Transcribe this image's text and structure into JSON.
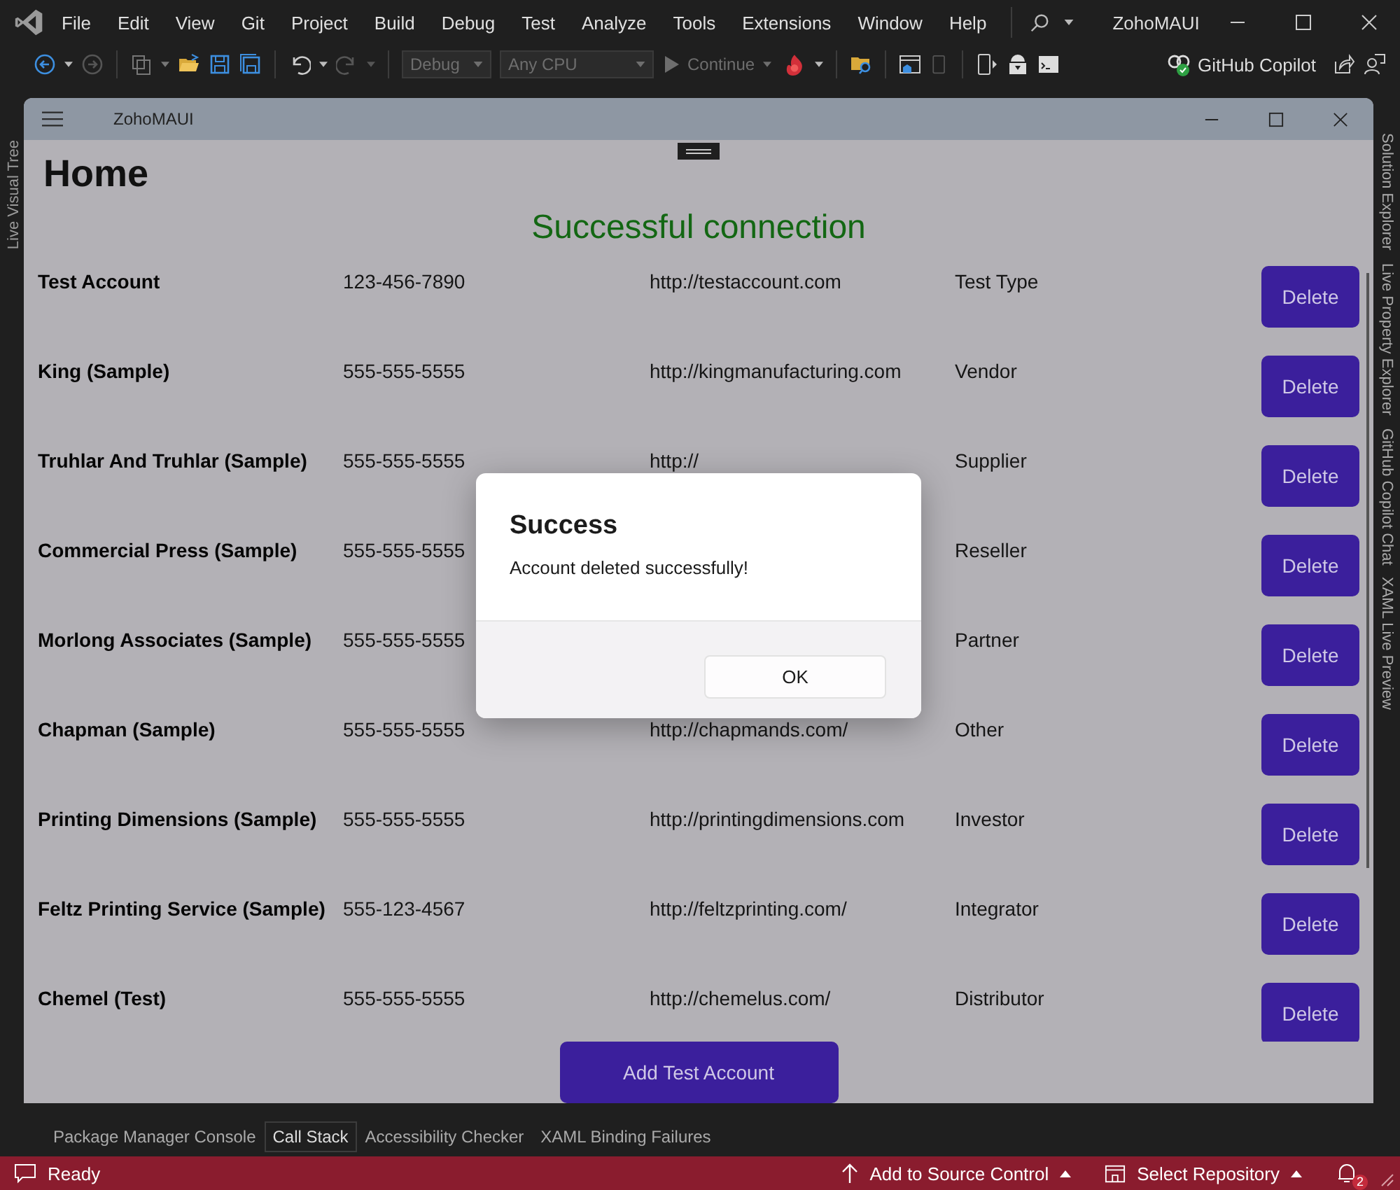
{
  "ide": {
    "menu": [
      "File",
      "Edit",
      "View",
      "Git",
      "Project",
      "Build",
      "Debug",
      "Test",
      "Analyze",
      "Tools",
      "Extensions",
      "Window",
      "Help"
    ],
    "title": "ZohoMAUI",
    "toolbar": {
      "configuration": {
        "value": "Debug",
        "disabled": true
      },
      "platform": {
        "value": "Any CPU",
        "disabled": true
      },
      "continue": {
        "label": "Continue",
        "disabled": true
      },
      "copilot": "GitHub Copilot"
    },
    "left_tabs": [
      "Live Visual Tree"
    ],
    "right_tabs": [
      "Solution Explorer",
      "Live Property Explorer",
      "GitHub Copilot Chat",
      "XAML Live Preview"
    ],
    "bottom_tabs": [
      {
        "label": "Package Manager Console",
        "selected": false
      },
      {
        "label": "Call Stack",
        "selected": true
      },
      {
        "label": "Accessibility Checker",
        "selected": false
      },
      {
        "label": "XAML Binding Failures",
        "selected": false
      }
    ],
    "status_bar": {
      "status": "Ready",
      "source_control": "Add to Source Control",
      "repository": "Select Repository",
      "notifications": "2"
    }
  },
  "app": {
    "title": "ZohoMAUI",
    "heading": "Home",
    "message": "Successful connection",
    "accounts": [
      {
        "name": "Test Account",
        "phone": "123-456-7890",
        "url": "http://testaccount.com",
        "type": "Test Type",
        "action": "Delete"
      },
      {
        "name": "King (Sample)",
        "phone": "555-555-5555",
        "url": "http://kingmanufacturing.com",
        "type": "Vendor",
        "action": "Delete"
      },
      {
        "name": "Truhlar And Truhlar (Sample)",
        "phone": "555-555-5555",
        "url": "http://",
        "type": "Supplier",
        "action": "Delete"
      },
      {
        "name": "Commercial Press (Sample)",
        "phone": "555-555-5555",
        "type": "Reseller",
        "action": "Delete"
      },
      {
        "name": "Morlong Associates (Sample)",
        "phone": "555-555-5555",
        "type": "Partner",
        "action": "Delete"
      },
      {
        "name": "Chapman (Sample)",
        "phone": "555-555-5555",
        "url": "http://chapmands.com/",
        "type": "Other",
        "action": "Delete"
      },
      {
        "name": "Printing Dimensions (Sample)",
        "phone": "555-555-5555",
        "url": "http://printingdimensions.com",
        "type": "Investor",
        "action": "Delete"
      },
      {
        "name": "Feltz Printing Service (Sample)",
        "phone": "555-123-4567",
        "url": "http://feltzprinting.com/",
        "type": "Integrator",
        "action": "Delete"
      },
      {
        "name": "Chemel (Test)",
        "phone": "555-555-5555",
        "url": "http://chemelus.com/",
        "type": "Distributor",
        "action": "Delete"
      }
    ],
    "add_button": "Add Test Account"
  },
  "dialog": {
    "title": "Success",
    "message": "Account deleted successfully!",
    "button": "OK"
  }
}
